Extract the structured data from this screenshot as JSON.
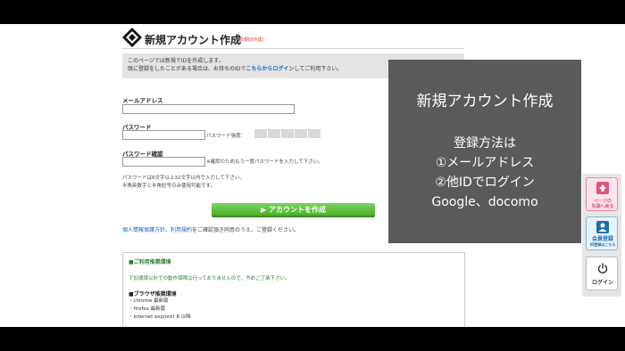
{
  "header": {
    "title": "新規アカウント作成",
    "subtitle": "[新規ID作成]"
  },
  "info": {
    "line1": "このページでは新規でIDを作成します。",
    "line2_pre": "既に登録をしたことがある場合は、お持ちのIDで",
    "line2_link": "こちらからログイン",
    "line2_post": "してご利用下さい。"
  },
  "form": {
    "email_label": "メールアドレス",
    "email_value": "",
    "password_label": "パスワード",
    "password_value": "",
    "strength_label": "パスワード強度：",
    "confirm_label": "パスワード確認",
    "confirm_value": "",
    "confirm_hint": "※確認のためもう一度パスワードを入力して下さい。",
    "note1": "パスワードは6文字以上32文字以内で入力して下さい。",
    "note2": "半角英数字と半角記号のみ使用可能です。",
    "create_button": "▶ アカウントを作成"
  },
  "agree": {
    "link1": "個人情報保護方針",
    "sep": "、",
    "link2": "利用規約",
    "rest": "をご確認頂き同意のうえ、ご登録ください。"
  },
  "environment": {
    "heading": "■ご利用推奨環境",
    "warning": "下記環境以外での動作保障は行っておりませんので、予めご了承下さい。",
    "browser_heading": "■ブラウザ推奨環境",
    "browsers": [
      "・chrome 最新版",
      "・firefox 最新版",
      "・Internet explorer 8 以降"
    ]
  },
  "overlay": {
    "title": "新規アカウント作成",
    "lines": [
      "登録方法は",
      "①メールアドレス",
      "②他IDでログイン",
      "Google、docomo"
    ]
  },
  "side_nav": {
    "top_label1": "ページの",
    "top_label2": "先頭へ戻る",
    "member_label": "会員登録",
    "member_sub": "ID登録はこちら",
    "login_label": "ログイン"
  },
  "colors": {
    "accent_green": "#4caf2a",
    "link_blue": "#1565c0",
    "overlay_gray": "#5a5a5a",
    "subtitle_red": "#e53935"
  }
}
